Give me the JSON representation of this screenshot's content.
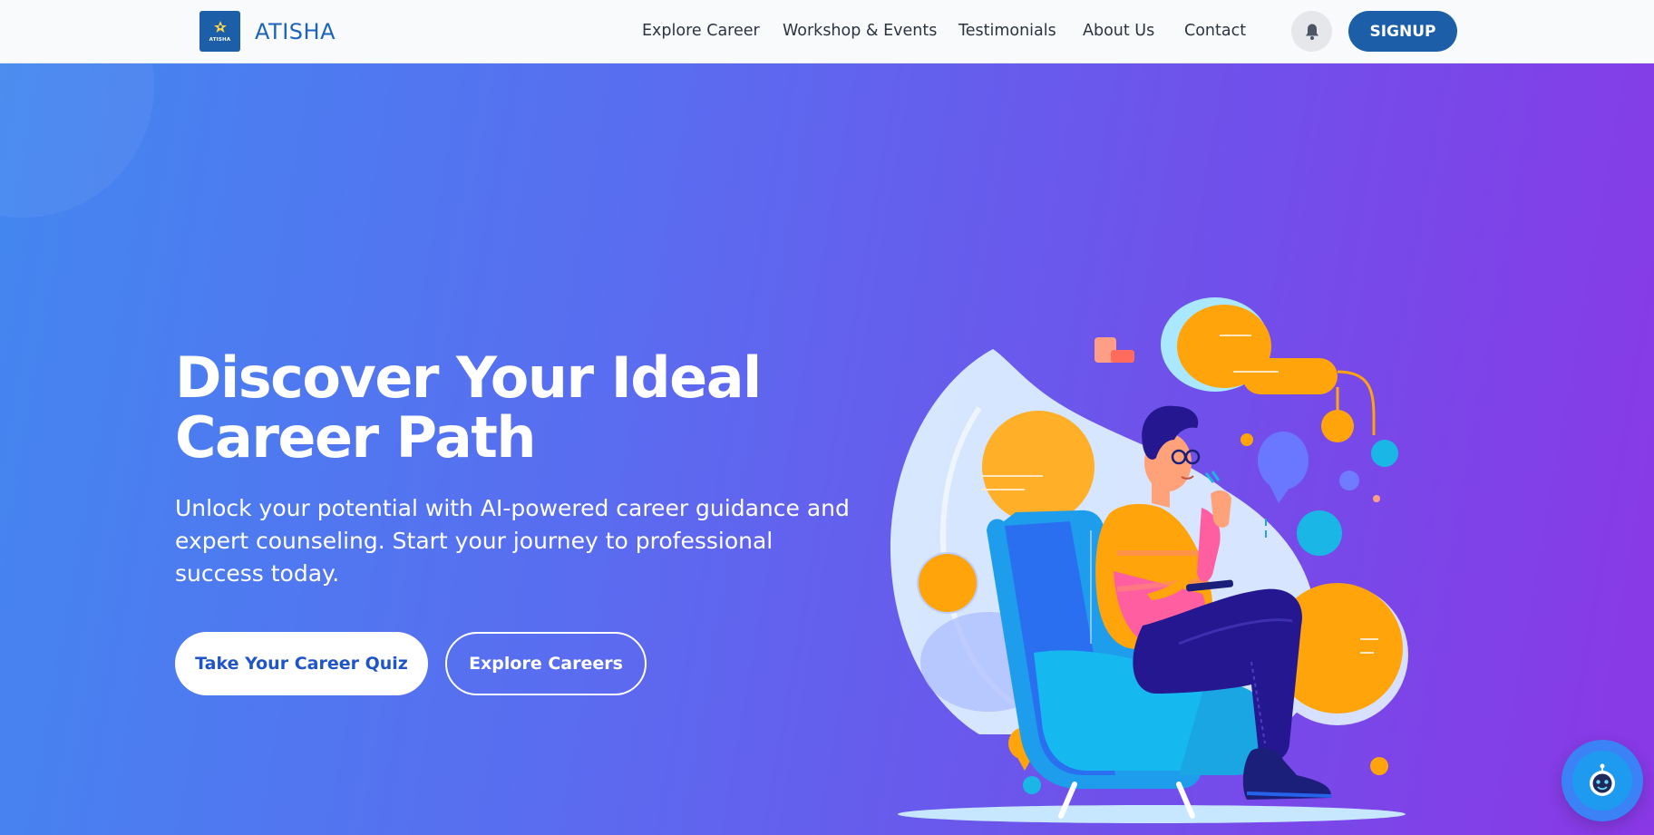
{
  "brand": {
    "name": "ATISHA",
    "logo_text": "ATISHA"
  },
  "nav": {
    "links": [
      "Explore Career",
      "Workshop & Events",
      "Testimonials",
      "About Us",
      "Contact"
    ],
    "signup_label": "SIGNUP",
    "notification_icon": "bell-icon"
  },
  "hero": {
    "title_line1": "Discover Your Ideal",
    "title_line2": "Career Path",
    "subtitle": "Unlock your potential with AI-powered career guidance and expert counseling. Start your journey to professional success today.",
    "primary_cta": "Take Your Career Quiz",
    "secondary_cta": "Explore Careers",
    "illustration": "person-sitting-in-armchair-with-phone-illustration"
  },
  "chatbot": {
    "icon": "robot-icon"
  },
  "colors": {
    "brand_blue": "#1c5fa8",
    "hero_gradient_start": "#4387f0",
    "hero_gradient_end": "#8a38e6",
    "cta_text": "#1f55c8",
    "accent_orange": "#ffa40b",
    "accent_cyan": "#19b6e6"
  }
}
